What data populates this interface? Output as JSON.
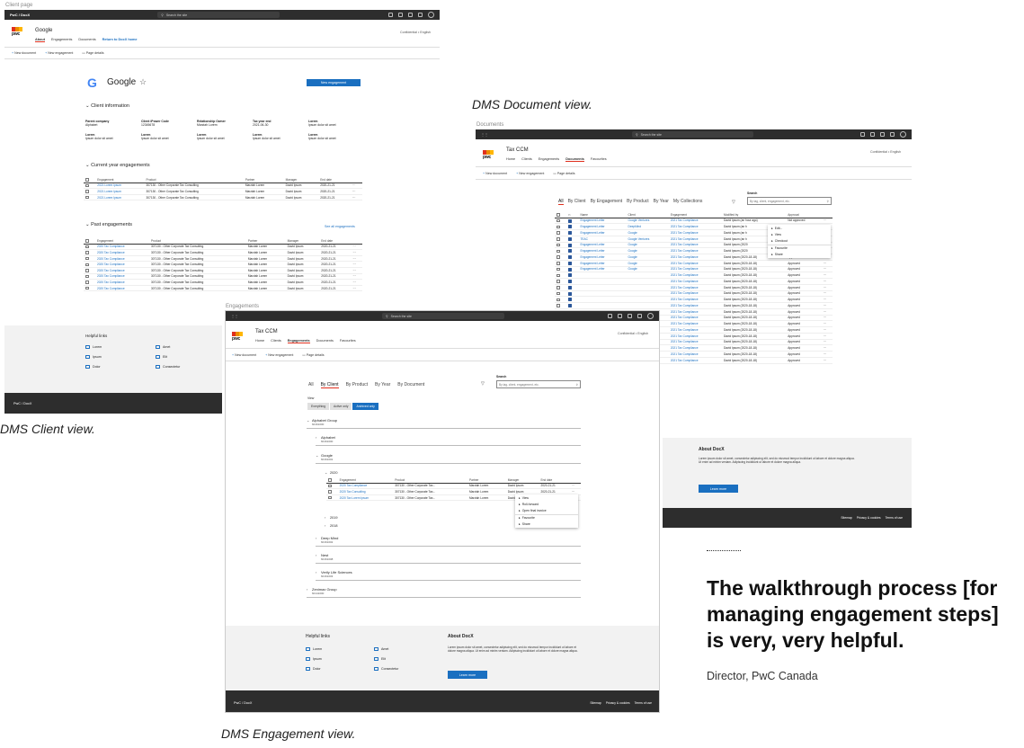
{
  "client_frame": {
    "label": "Client page",
    "app_title": "PwC / DocX",
    "search_placeholder": "Search the site",
    "client_name": "Google",
    "nav": [
      "About",
      "Engagements",
      "Documents",
      "Return to DocX home"
    ],
    "subnav": [
      "New document",
      "New engagement",
      "Page details"
    ],
    "lang": "Confidential  •  English",
    "new_engagement": "New engagement",
    "client_info_title": "Client information",
    "info": [
      {
        "k": "Parent company",
        "v": "Alphabet"
      },
      {
        "k": "Client iPower Code",
        "v": "12345678"
      },
      {
        "k": "Relationship Owner",
        "v": "Marziah Lorem"
      },
      {
        "k": "Tax year end",
        "v": "2021-06-30"
      },
      {
        "k": "Lorem",
        "v": "Ipsum dolor sit amet"
      },
      {
        "k": "Lorem",
        "v": "Ipsum dolor sit amet"
      },
      {
        "k": "Lorem",
        "v": "Ipsum dolor sit amet"
      },
      {
        "k": "Lorem",
        "v": "Ipsum dolor sit amet"
      },
      {
        "k": "Lorem",
        "v": "Ipsum dolor sit amet"
      },
      {
        "k": "Lorem",
        "v": "Ipsum dolor sit amet"
      }
    ],
    "current_title": "Current year engagements",
    "past_title": "Past engagements",
    "see_all": "See all engagements",
    "cols": [
      "Engagement",
      "Product",
      "Partner",
      "Manager",
      "End date"
    ],
    "current_rows": [
      [
        "2021 Lorem Ipsum",
        "307130 - Other Corporate Tax Consulting",
        "Marziah Lorem",
        "David Ipsum",
        "2020-21-21"
      ],
      [
        "2021 Lorem Ipsum",
        "307130 - Other Corporate Tax Consulting",
        "Marziah Lorem",
        "David Ipsum",
        "2020-21-21"
      ],
      [
        "2021 Lorem Ipsum",
        "307130 - Other Corporate Tax Consulting",
        "Marziah Lorem",
        "David Ipsum",
        "2020-21-21"
      ]
    ],
    "past_rows": [
      [
        "2020 Tax Compliance",
        "307130 - Other Corporate Tax Consulting",
        "Marziah Lorem",
        "David Ipsum",
        "2020-21-21"
      ],
      [
        "2020 Tax Compliance",
        "307130 - Other Corporate Tax Consulting",
        "Marziah Lorem",
        "David Ipsum",
        "2020-21-21"
      ],
      [
        "2020 Tax Compliance",
        "307130 - Other Corporate Tax Consulting",
        "Marziah Lorem",
        "David Ipsum",
        "2020-21-21"
      ],
      [
        "2020 Tax Compliance",
        "307130 - Other Corporate Tax Consulting",
        "Marziah Lorem",
        "David Ipsum",
        "2020-21-21"
      ],
      [
        "2020 Tax Compliance",
        "307130 - Other Corporate Tax Consulting",
        "Marziah Lorem",
        "David Ipsum",
        "2020-21-21"
      ],
      [
        "2020 Tax Compliance",
        "307130 - Other Corporate Tax Consulting",
        "Marziah Lorem",
        "David Ipsum",
        "2020-21-21"
      ],
      [
        "2020 Tax Compliance",
        "307130 - Other Corporate Tax Consulting",
        "Marziah Lorem",
        "David Ipsum",
        "2020-21-21"
      ],
      [
        "2020 Tax Compliance",
        "307130 - Other Corporate Tax Consulting",
        "Marziah Lorem",
        "David Ipsum",
        "2020-21-21"
      ]
    ],
    "helpful_title": "Helpful links",
    "links": [
      "Lorem",
      "Amet",
      "Ipsum",
      "Elit",
      "Dolor",
      "Consectetur"
    ],
    "footer": "PwC / DocX",
    "caption": "DMS Client view."
  },
  "doc_frame": {
    "label": "Documents",
    "app_name": "Tax CCM",
    "search_placeholder": "Search the site",
    "nav": [
      "Home",
      "Clients",
      "Engagements",
      "Documents",
      "Favourites"
    ],
    "subnav": [
      "New document",
      "New engagement",
      "Page details"
    ],
    "lang": "Confidential  •  English",
    "filters": [
      "All",
      "By Client",
      "By Engagement",
      "By Product",
      "By Year",
      "My Collections"
    ],
    "search_label": "Search",
    "search_ph": "By tag, client, engagement, etc.",
    "cols": [
      "Name",
      "Client",
      "Engagement",
      "Modified by",
      "Approval"
    ],
    "rows": [
      [
        "Engagement Letter",
        "Google Ventures",
        "2021 Tax Compliance",
        "David Ipsum (an hour ago)",
        "Not approved"
      ],
      [
        "Engagement Letter",
        "DeepMind",
        "2021 Tax Compliance",
        "David Ipsum (an h",
        ""
      ],
      [
        "Engagement Letter",
        "Google",
        "2021 Tax Compliance",
        "David Ipsum (an h",
        ""
      ],
      [
        "TEAC",
        "Google Ventures",
        "2021 Tax Compliance",
        "David Ipsum (an h",
        ""
      ],
      [
        "Engagement Letter",
        "Google",
        "2021 Tax Compliance",
        "David Ipsum (2020",
        ""
      ],
      [
        "Engagement Letter",
        "Google",
        "2021 Tax Compliance",
        "David Ipsum (2020",
        ""
      ],
      [
        "Engagement Letter",
        "Google",
        "2021 Tax Compliance",
        "David Ipsum (2020-18-18)",
        "Approved"
      ],
      [
        "Engagement Letter",
        "Google",
        "2021 Tax Compliance",
        "David Ipsum (2020-18-18)",
        "Approved"
      ],
      [
        "Engagement Letter",
        "Google",
        "2021 Tax Compliance",
        "David Ipsum (2020-18-18)",
        "Approved"
      ],
      [
        "",
        "",
        "2021 Tax Compliance",
        "David Ipsum (2020-18-18)",
        "Approved"
      ],
      [
        "",
        "",
        "2021 Tax Compliance",
        "David Ipsum (2020-18-18)",
        "Approved"
      ],
      [
        "",
        "",
        "2021 Tax Compliance",
        "David Ipsum (2020-18-18)",
        "Approved"
      ],
      [
        "",
        "",
        "2021 Tax Compliance",
        "David Ipsum (2020-18-18)",
        "Approved"
      ],
      [
        "",
        "",
        "2021 Tax Compliance",
        "David Ipsum (2020-18-18)",
        "Approved"
      ],
      [
        "",
        "",
        "2021 Tax Compliance",
        "David Ipsum (2020-18-18)",
        "Approved"
      ],
      [
        "",
        "",
        "2021 Tax Compliance",
        "David Ipsum (2020-18-18)",
        "Approved"
      ],
      [
        "",
        "",
        "2021 Tax Compliance",
        "David Ipsum (2020-18-18)",
        "Approved"
      ],
      [
        "",
        "",
        "2021 Tax Compliance",
        "David Ipsum (2020-18-18)",
        "Approved"
      ],
      [
        "",
        "",
        "2021 Tax Compliance",
        "David Ipsum (2020-18-18)",
        "Approved"
      ],
      [
        "",
        "",
        "2021 Tax Compliance",
        "David Ipsum (2020-18-18)",
        "Approved"
      ],
      [
        "",
        "",
        "2021 Tax Compliance",
        "David Ipsum (2020-18-18)",
        "Approved"
      ],
      [
        "",
        "",
        "2021 Tax Compliance",
        "David Ipsum (2020-18-18)",
        "Approved"
      ],
      [
        "",
        "",
        "2021 Tax Compliance",
        "David Ipsum (2020-18-18)",
        "Approved"
      ],
      [
        "",
        "",
        "2021 Tax Compliance",
        "David Ipsum (2020-18-18)",
        "Approved"
      ]
    ],
    "menu": [
      "Edit...",
      "View",
      "Checkout",
      "Favourite",
      "Share"
    ],
    "about_title": "About DocX",
    "about_text": "Lorem ipsum dolor sit amet, consectetur adipiscing elit, sed do eiusmod tempor incididunt ut labore et dolore magna aliqua. Ut enim ad minim veniam. Adipiscing incididunt ut labore et dolore magna aliqua.",
    "learn_more": "Learn more",
    "footer_links": [
      "Sitemap",
      "Privacy & cookies",
      "Terms of use"
    ],
    "caption": "DMS Document view."
  },
  "eng_frame": {
    "label": "Engagements",
    "app_name": "Tax CCM",
    "search_placeholder": "Search the site",
    "nav": [
      "Home",
      "Clients",
      "Engagements",
      "Documents",
      "Favourites"
    ],
    "subnav": [
      "New document",
      "New engagement",
      "Page details"
    ],
    "lang": "Confidential  •  English",
    "filters": [
      "All",
      "By Client",
      "By Product",
      "By Year",
      "By Document"
    ],
    "search_label": "Search",
    "search_ph": "By tag, client, engagement, etc.",
    "view_label": "View",
    "view_opts": [
      "Everything",
      "Active only",
      "Archived only"
    ],
    "groups": [
      {
        "name": "Alphabet Group",
        "num": "60161000"
      },
      {
        "name": "Alphabet",
        "num": "60161000"
      },
      {
        "name": "Google",
        "num": "60161001"
      },
      {
        "name": "Deep Mind",
        "num": "60161002"
      },
      {
        "name": "Nest",
        "num": "60161008"
      },
      {
        "name": "Verily Life Sciences",
        "num": "60161003"
      },
      {
        "name": "Zenimax Group",
        "num": "60141000"
      }
    ],
    "years": [
      "2020",
      "2019",
      "2018"
    ],
    "cols": [
      "Engagement",
      "Product",
      "Partner",
      "Manager",
      "End date"
    ],
    "rows": [
      [
        "2020 Tax Compliance",
        "307130 - Other Corporate Tax...",
        "Marziah Lorem",
        "David Ipsum",
        "2020-21-21"
      ],
      [
        "2020 Tax Consulting",
        "307130 - Other Corporate Tax...",
        "Marziah Lorem",
        "David Ipsum",
        "2020-21-21"
      ],
      [
        "2020 Tax Lorem Ipsum",
        "307130 - Other Corporate Tax...",
        "Marziah Lorem",
        "David Ipsum",
        "2020-21-21"
      ]
    ],
    "menu": [
      "View",
      "Roll-forward",
      "Open final invoice",
      "Favourite",
      "Share"
    ],
    "helpful_title": "Helpful links",
    "links": [
      "Lorem",
      "Amet",
      "Ipsum",
      "Elit",
      "Dolor",
      "Consectetur"
    ],
    "about_title": "About DocX",
    "about_text": "Lorem ipsum dolor sit amet, consectetur adipiscing elit, sed do eiusmod tempor incididunt ut labore et dolore magna aliqua. Ut enim ad minim veniam. Adipiscing incididunt ut labore et dolore magna aliqua.",
    "learn_more": "Learn more",
    "footer": "PwC / DocX",
    "footer_links": [
      "Sitemap",
      "Privacy & cookies",
      "Terms of use"
    ],
    "caption": "DMS Engagement view."
  },
  "quote": "The walkthrough process [for managing engagement steps] is very, very helpful.",
  "attribution": "Director, PwC Canada",
  "colors": {
    "accent": "#1a6fc0",
    "brand_red": "#e0301e",
    "dark": "#2d2d2d"
  }
}
